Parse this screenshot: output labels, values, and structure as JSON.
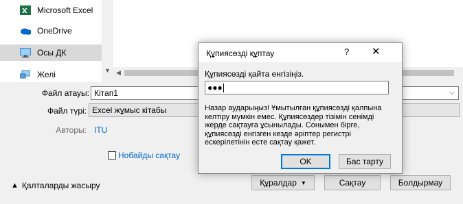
{
  "nav": {
    "items": [
      {
        "label": "Microsoft Excel",
        "icon": "excel-icon"
      },
      {
        "label": "OneDrive",
        "icon": "onedrive-icon"
      },
      {
        "label": "Осы ДК",
        "icon": "this-pc-icon",
        "selected": true
      },
      {
        "label": "Желі",
        "icon": "network-icon"
      }
    ]
  },
  "form": {
    "filename_label": "Файл атауы:",
    "filename_value": "Кітап1",
    "filetype_label": "Файл түрі:",
    "filetype_value": "Excel жұмыс кітабы",
    "authors_label": "Авторы:",
    "authors_value": "ITU",
    "thumbnail_label": "Нобайды сақтау",
    "hide_folders_label": "Қалталарды жасыру",
    "tools_label": "Құралдар",
    "save_label": "Сақтау",
    "cancel_label": "Болдырмау"
  },
  "dialog": {
    "title": "Құпиясөзді құптау",
    "help": "?",
    "close": "✕",
    "prompt": "Құпиясөзді қайта енгізіңіз.",
    "password_masked": "●●●",
    "warning": "Назар аударыңыз! Ұмытылған құпиясөзді қалпына келтіру мүмкін емес. Құпиясөздер тізімін сенімді жерде сақтауға ұсынылады. Сонымен бірге, құпиясөзді енгізген кезде әріптер регистрі ескерілетінін есте сақтау қажет.",
    "ok_label": "OK",
    "cancel_label": "Бас тарту"
  },
  "colors": {
    "accent": "#0078d7",
    "link": "#0066cc"
  }
}
